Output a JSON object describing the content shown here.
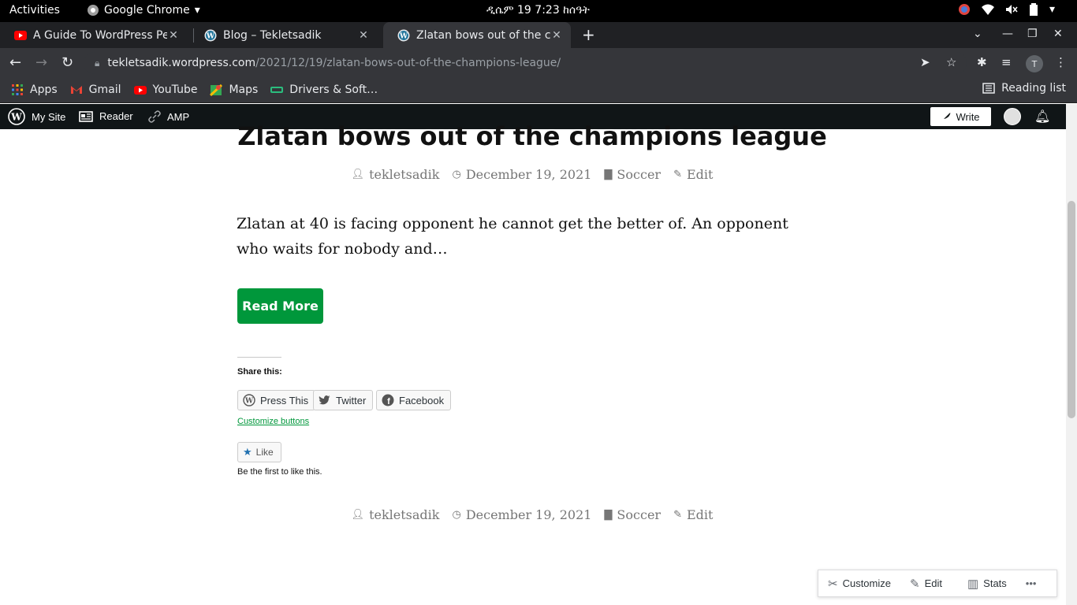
{
  "system": {
    "activities": "Activities",
    "app_menu": "Google Chrome",
    "clock": "ዲሴም 19  7:23 ከሰዓት"
  },
  "tabs": [
    {
      "title": "A Guide To WordPress Pe",
      "favicon": "youtube-icon"
    },
    {
      "title": "Blog – Tekletsadik",
      "favicon": "wordpress-icon"
    },
    {
      "title": "Zlatan bows out of the ch",
      "favicon": "wordpress-icon",
      "active": true
    }
  ],
  "omnibox": {
    "host": "tekletsadik.wordpress.com",
    "path": "/2021/12/19/zlatan-bows-out-of-the-champions-league/"
  },
  "profile_initial": "T",
  "bookmarks": [
    {
      "label": "Apps",
      "icon": "apps-grid-icon"
    },
    {
      "label": "Gmail",
      "icon": "gmail-icon"
    },
    {
      "label": "YouTube",
      "icon": "youtube-icon"
    },
    {
      "label": "Maps",
      "icon": "maps-icon"
    },
    {
      "label": "Drivers & Soft…",
      "icon": "drivers-icon"
    }
  ],
  "reading_list": "Reading list",
  "adminbar": {
    "my_site": "My Site",
    "reader": "Reader",
    "amp": "AMP",
    "write": "Write"
  },
  "post": {
    "title": "Zlatan bows out of the champions league",
    "author": "tekletsadik",
    "date": "December 19, 2021",
    "category": "Soccer",
    "edit": "Edit",
    "excerpt": "Zlatan at 40 is facing opponent he cannot get the better of. An opponent who waits for nobody and…",
    "read_more": "Read More"
  },
  "share": {
    "title": "Share this:",
    "buttons": [
      "Press This",
      "Twitter",
      "Facebook"
    ],
    "customize": "Customize buttons"
  },
  "like": {
    "label": "Like",
    "note": "Be the first to like this."
  },
  "actions": {
    "customize": "Customize",
    "edit": "Edit",
    "stats": "Stats",
    "more": "•••"
  },
  "colors": {
    "accent_green": "#00973b",
    "adminbar": "#101517",
    "chrome_dark": "#35363a"
  }
}
